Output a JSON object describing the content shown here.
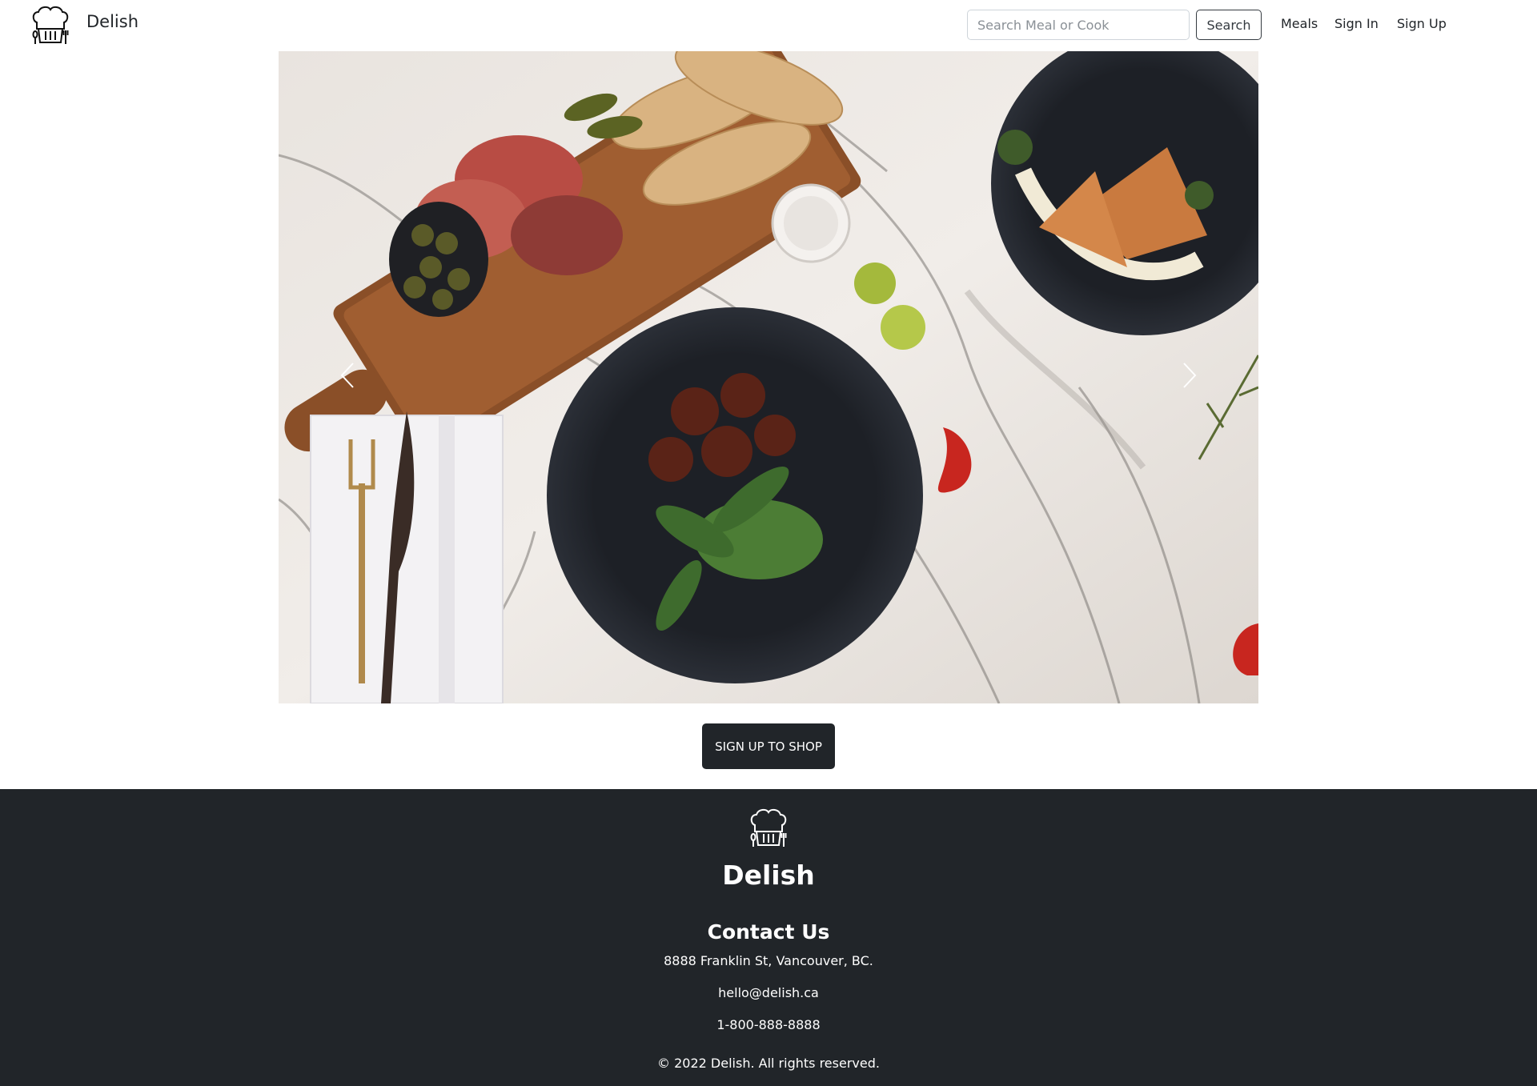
{
  "header": {
    "brand_name": "Delish",
    "search": {
      "placeholder": "Search Meal or Cook",
      "value": ""
    },
    "search_button_label": "Search",
    "nav": {
      "meals": "Meals",
      "sign_in": "Sign In",
      "sign_up": "Sign Up"
    }
  },
  "hero": {
    "icons": {
      "prev": "chevron-left-icon",
      "next": "chevron-right-icon"
    }
  },
  "cta": {
    "label": "SIGN UP TO SHOP"
  },
  "footer": {
    "brand_name": "Delish",
    "contact_title": "Contact Us",
    "address": "8888 Franklin St, Vancouver, BC.",
    "email": "hello@delish.ca",
    "phone": "1-800-888-8888",
    "copyright": "© 2022 Delish. All rights reserved."
  },
  "colors": {
    "dark": "#212529",
    "background": "#ffffff",
    "text_on_dark": "#ffffff"
  }
}
